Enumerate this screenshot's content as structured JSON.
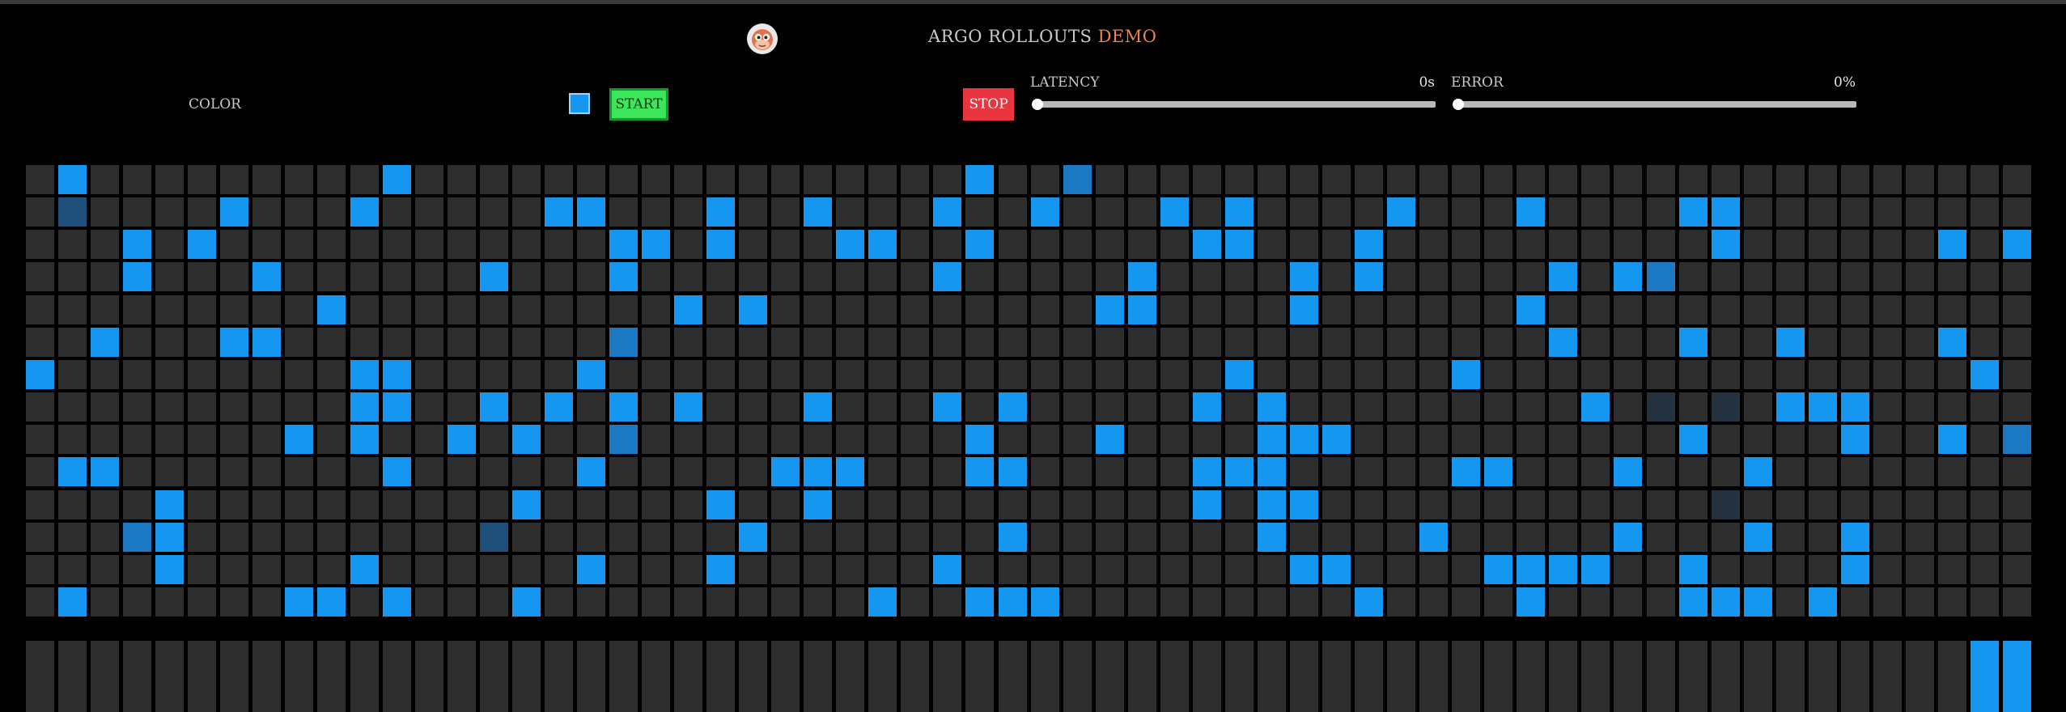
{
  "header": {
    "title_prefix": "ARGO ROLLOUTS",
    "title_accent": "DEMO",
    "logo_icon": "argo-logo-icon"
  },
  "controls": {
    "color_label": "COLOR",
    "color_value": "#1596f0",
    "start_label": "START",
    "stop_label": "STOP",
    "latency": {
      "label": "LATENCY",
      "value": "0s",
      "level": 0
    },
    "error": {
      "label": "ERROR",
      "value": "0%",
      "level": 0
    }
  },
  "colors": {
    "accent": "#f5813f",
    "blue": "#1596f0",
    "start_green": "#3de55a",
    "stop_red": "#e8353f"
  },
  "grid": {
    "columns": 62,
    "rows": [
      [
        1,
        11,
        29,
        32
      ],
      [
        1,
        6,
        10,
        16,
        17,
        21,
        24,
        28,
        31,
        35,
        37,
        42,
        46,
        51,
        52
      ],
      [
        3,
        5,
        18,
        19,
        21,
        25,
        26,
        29,
        36,
        37,
        41,
        52,
        59,
        61
      ],
      [
        3,
        7,
        14,
        18,
        28,
        34,
        39,
        41,
        47,
        49,
        50
      ],
      [
        9,
        20,
        22,
        33,
        34,
        39,
        46
      ],
      [
        2,
        6,
        7,
        18,
        47,
        51,
        54,
        59
      ],
      [
        0,
        10,
        11,
        17,
        37,
        44,
        60
      ],
      [
        10,
        11,
        14,
        16,
        18,
        20,
        24,
        28,
        30,
        36,
        38,
        48,
        50,
        52,
        54,
        55,
        56
      ],
      [
        8,
        10,
        13,
        15,
        18,
        29,
        33,
        38,
        39,
        40,
        51,
        56,
        59,
        61
      ],
      [
        1,
        2,
        11,
        17,
        23,
        24,
        25,
        29,
        30,
        36,
        37,
        38,
        44,
        45,
        49,
        53
      ],
      [
        4,
        15,
        21,
        24,
        36,
        38,
        39,
        52
      ],
      [
        3,
        4,
        14,
        22,
        30,
        38,
        43,
        49,
        53,
        56
      ],
      [
        4,
        10,
        17,
        21,
        28,
        39,
        40,
        45,
        46,
        47,
        48,
        51,
        56
      ],
      [
        1,
        8,
        9,
        11,
        15,
        26,
        29,
        30,
        31,
        41,
        46,
        51,
        52,
        53,
        55
      ]
    ],
    "shaded": [
      {
        "row": 0,
        "col": 32,
        "tone": "dim"
      },
      {
        "row": 1,
        "col": 1,
        "tone": "dark"
      },
      {
        "row": 3,
        "col": 50,
        "tone": "dim"
      },
      {
        "row": 5,
        "col": 18,
        "tone": "dim"
      },
      {
        "row": 7,
        "col": 50,
        "tone": "faint"
      },
      {
        "row": 7,
        "col": 52,
        "tone": "faint"
      },
      {
        "row": 8,
        "col": 18,
        "tone": "dim"
      },
      {
        "row": 8,
        "col": 61,
        "tone": "dim"
      },
      {
        "row": 10,
        "col": 52,
        "tone": "faint"
      },
      {
        "row": 11,
        "col": 3,
        "tone": "dim"
      },
      {
        "row": 11,
        "col": 14,
        "tone": "dark"
      }
    ]
  },
  "bars": {
    "count": 62,
    "active": [
      60,
      61
    ]
  }
}
